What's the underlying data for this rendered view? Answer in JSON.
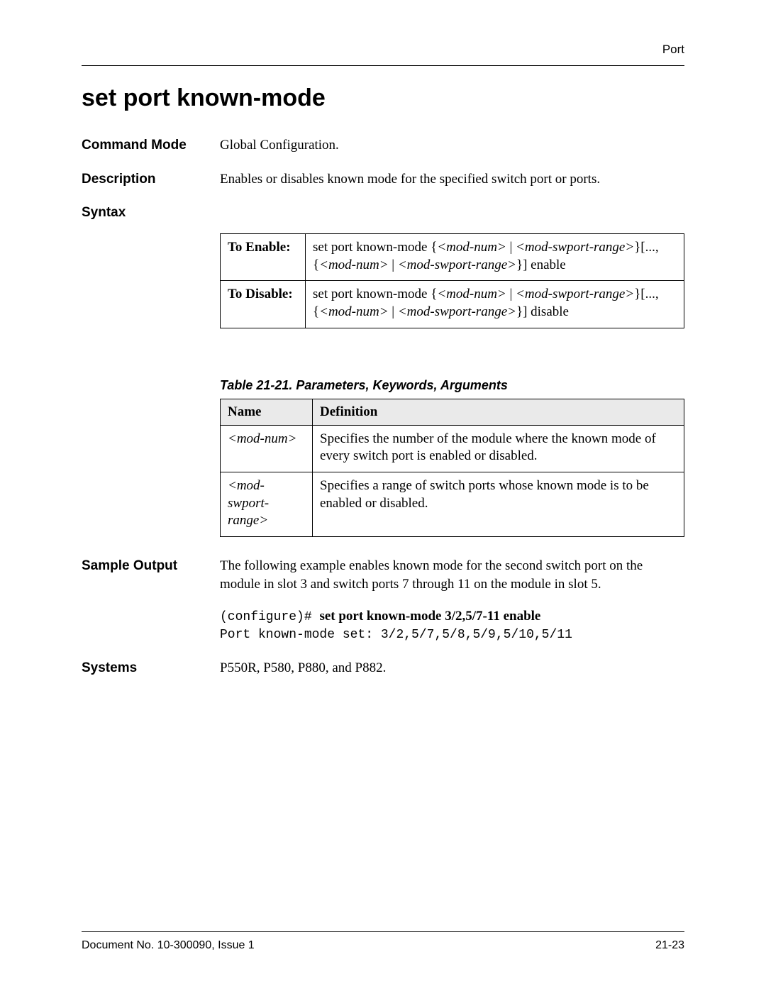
{
  "header": {
    "section_name": "Port"
  },
  "title": "set port known-mode",
  "command_mode": {
    "label": "Command Mode",
    "value": "Global Configuration."
  },
  "description": {
    "label": "Description",
    "value": "Enables or disables known mode for the specified switch port or ports."
  },
  "syntax": {
    "label": "Syntax",
    "rows": [
      {
        "label": "To Enable:",
        "text_pre": "set port known-mode {",
        "arg1": "<mod-num>",
        "text_mid1": " | ",
        "arg2": "<mod-swport-range>",
        "text_mid2": "}[...,{",
        "arg3": "<mod-num>",
        "text_mid3": " | ",
        "arg4": "<mod-swport-range>",
        "text_post": "}] enable"
      },
      {
        "label": "To Disable:",
        "text_pre": "set port known-mode {",
        "arg1": "<mod-num>",
        "text_mid1": " | ",
        "arg2": "<mod-swport-range>",
        "text_mid2": "}[...,{",
        "arg3": "<mod-num>",
        "text_mid3": " | ",
        "arg4": "<mod-swport-range>",
        "text_post": "}] disable"
      }
    ]
  },
  "params_table": {
    "caption": "Table 21-21.  Parameters, Keywords, Arguments",
    "head_name": "Name",
    "head_def": "Definition",
    "rows": [
      {
        "name": "<mod-num>",
        "def": "Specifies the number of the module where the known mode of every switch port is enabled or disabled."
      },
      {
        "name": "<mod-swport-range>",
        "def": "Specifies a range of switch ports whose known mode is to be enabled or disabled."
      }
    ]
  },
  "sample_output": {
    "label": "Sample Output",
    "intro": "The following example enables known mode for the second switch port on the module in slot 3 and switch ports 7 through 11 on the module in slot 5.",
    "prompt": "(configure)# ",
    "command": "set port known-mode 3/2,5/7-11 enable",
    "result": "Port known-mode set: 3/2,5/7,5/8,5/9,5/10,5/11"
  },
  "systems": {
    "label": "Systems",
    "value": "P550R, P580, P880, and P882."
  },
  "footer": {
    "doc": "Document No. 10-300090, Issue 1",
    "page": "21-23"
  }
}
